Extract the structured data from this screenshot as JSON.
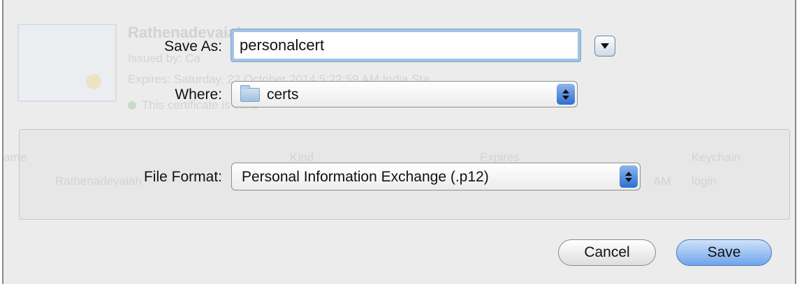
{
  "dialog": {
    "save_as_label": "Save As:",
    "filename": "personalcert",
    "where_label": "Where:",
    "where_value": "certs",
    "file_format_label": "File Format:",
    "file_format_value": "Personal Information Exchange (.p12)",
    "cancel_label": "Cancel",
    "save_label": "Save"
  },
  "background": {
    "cert_name": "Rathenadevaiah",
    "issued_by": "Issued by: Ca",
    "expires": "Expires: Saturday, 22 October 2014 5:22:59 AM India Sta",
    "valid_note": "This certificate is valid",
    "table": {
      "col_name": "ame",
      "col_kind": "Kind",
      "col_expires": "Expires",
      "col_keychain": "Keychain",
      "row_name": "Rathenadevaiah",
      "row_time": "AM",
      "row_keychain": "login"
    }
  },
  "colors": {
    "focus_ring": "#a3c2e6",
    "accent_blue": "#2d6fd1",
    "sheet_background": "#ececec"
  },
  "icons": {
    "where_folder": "folder-icon",
    "disclosure": "triangle-down-icon",
    "popup_stepper": "up-down-arrows-icon"
  }
}
